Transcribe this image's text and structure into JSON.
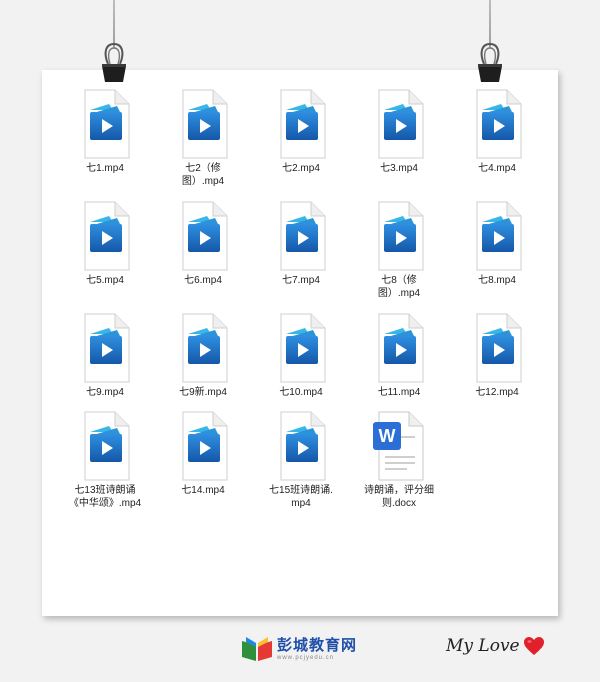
{
  "files": [
    {
      "name": "七1.mp4",
      "type": "video"
    },
    {
      "name": "七2（修图）.mp4",
      "type": "video"
    },
    {
      "name": "七2.mp4",
      "type": "video"
    },
    {
      "name": "七3.mp4",
      "type": "video"
    },
    {
      "name": "七4.mp4",
      "type": "video"
    },
    {
      "name": "七5.mp4",
      "type": "video"
    },
    {
      "name": "七6.mp4",
      "type": "video"
    },
    {
      "name": "七7.mp4",
      "type": "video"
    },
    {
      "name": "七8（修图）.mp4",
      "type": "video"
    },
    {
      "name": "七8.mp4",
      "type": "video"
    },
    {
      "name": "七9.mp4",
      "type": "video"
    },
    {
      "name": "七9新.mp4",
      "type": "video"
    },
    {
      "name": "七10.mp4",
      "type": "video"
    },
    {
      "name": "七11.mp4",
      "type": "video"
    },
    {
      "name": "七12.mp4",
      "type": "video"
    },
    {
      "name": "七13班诗朗诵《中华颂》.mp4",
      "type": "video"
    },
    {
      "name": "七14.mp4",
      "type": "video"
    },
    {
      "name": "七15班诗朗诵.mp4",
      "type": "video"
    },
    {
      "name": "诗朗诵，评分细则.docx",
      "type": "word"
    }
  ],
  "footer": {
    "brand_name": "彭城教育网",
    "brand_url": "www.pcjyedu.cn",
    "signature": "My Love"
  },
  "colors": {
    "video_icon_blue": "#1e74c6",
    "word_icon_blue": "#2b6fd6",
    "brand_blue": "#1f4fa8",
    "heart_red": "#e0202a"
  }
}
